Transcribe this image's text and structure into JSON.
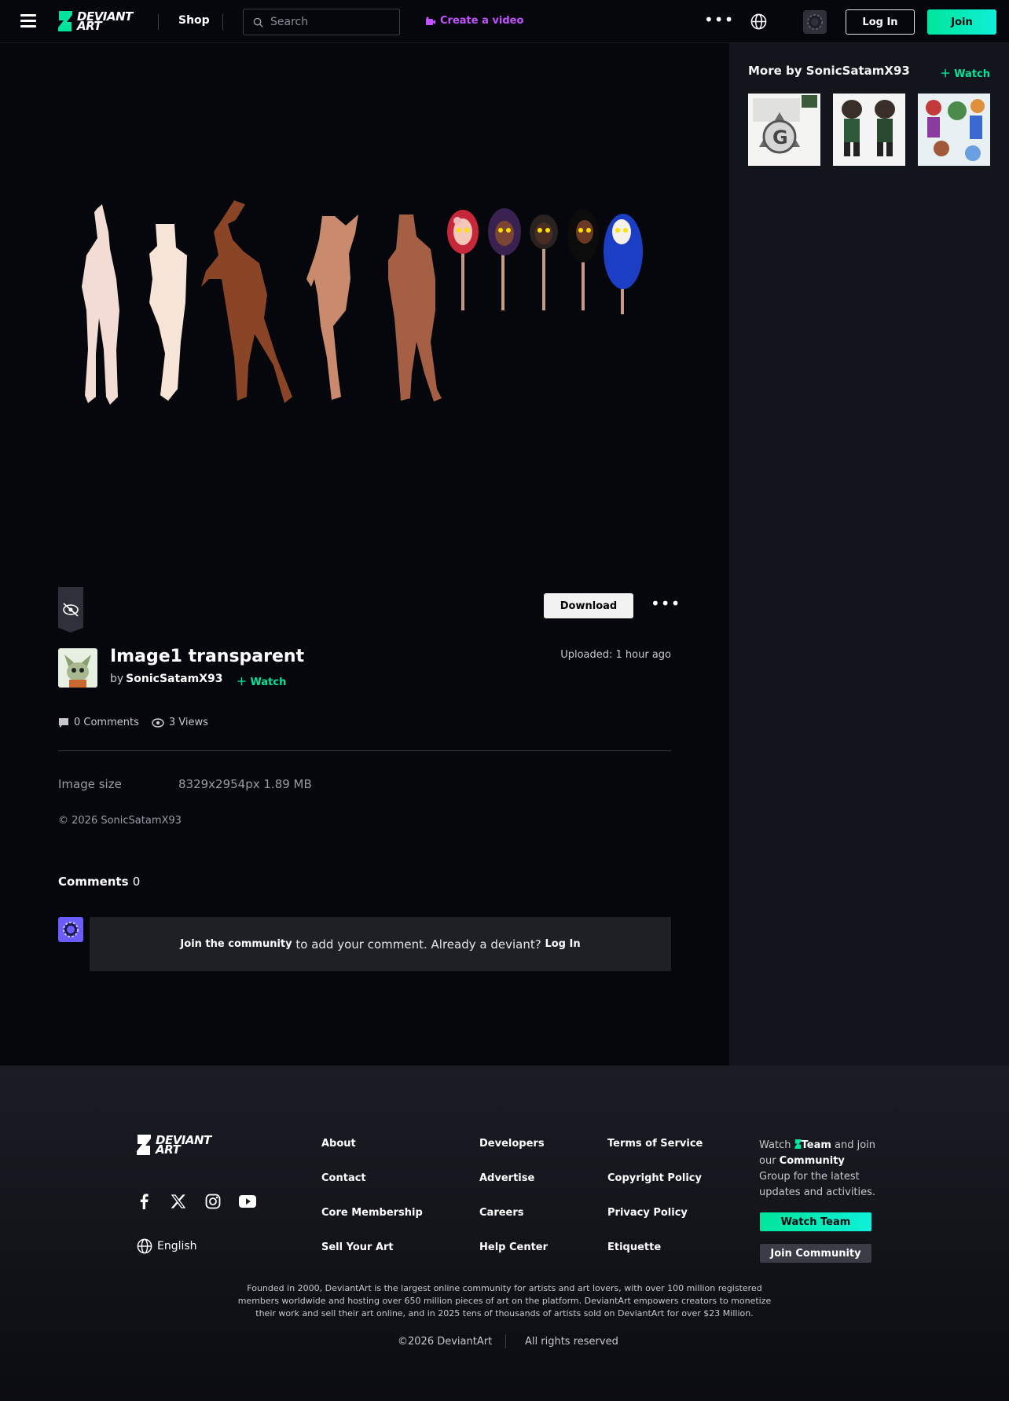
{
  "header": {
    "logo_line1": "DEVIANT",
    "logo_line2": "ART",
    "shop": "Shop",
    "search_placeholder": "Search",
    "create_video": "Create a video",
    "login": "Log In",
    "join": "Join",
    "accent": "#00e59b",
    "video_color": "#c253ff"
  },
  "sidebar": {
    "title": "More by SonicSatamX93",
    "watch": "Watch",
    "thumbnails": [
      "thumbnail-1",
      "thumbnail-2",
      "thumbnail-3"
    ]
  },
  "deviation": {
    "download": "Download",
    "title": "Image1 transparent",
    "by": "by",
    "author": "SonicSatamX93",
    "watch": "Watch",
    "uploaded": "Uploaded: 1 hour ago",
    "comments_count": "0 Comments",
    "views_count": "3 Views",
    "image_size_label": "Image size",
    "image_size_value": "8329x2954px 1.89 MB",
    "copyright": "© 2026 SonicSatamX93"
  },
  "comments": {
    "heading": "Comments",
    "count": "0",
    "join_link": "Join the community",
    "middle": " to add your comment. Already a deviant? ",
    "login_link": "Log In"
  },
  "footer": {
    "logo_line1": "DEVIANT",
    "logo_line2": "ART",
    "language": "English",
    "col1": [
      "About",
      "Contact",
      "Core Membership",
      "Sell Your Art"
    ],
    "col2": [
      "Developers",
      "Advertise",
      "Careers",
      "Help Center"
    ],
    "col3": [
      "Terms of Service",
      "Copyright Policy",
      "Privacy Policy",
      "Etiquette"
    ],
    "watch_text_pre": "Watch ",
    "watch_team": "Team",
    "watch_text_mid": " and join our ",
    "watch_community": "Community",
    "watch_text_post": " Group for the latest updates and activities.",
    "watch_team_btn": "Watch Team",
    "join_community_btn": "Join Community",
    "about_text": "Founded in 2000, DeviantArt is the largest online community for artists and art lovers, with over 100 million registered members worldwide and hosting over 650 million pieces of art on the platform. DeviantArt empowers creators to monetize their work and sell their art online, and in 2025 tens of thousands of artists sold on DeviantArt for over $23 Million.",
    "copyright": "©2026 DeviantArt",
    "rights": "All rights reserved"
  }
}
